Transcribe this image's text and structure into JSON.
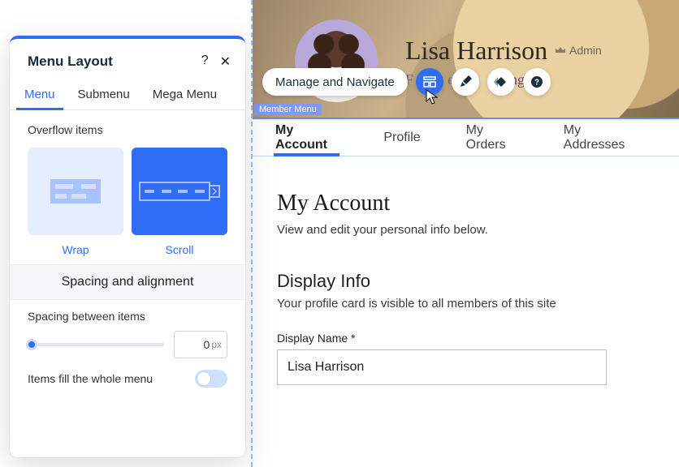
{
  "panel": {
    "title": "Menu Layout",
    "tabs": [
      "Menu",
      "Submenu",
      "Mega Menu"
    ],
    "activeTab": 0,
    "overflow_label": "Overflow items",
    "option_wrap": "Wrap",
    "option_scroll": "Scroll",
    "spacing_heading": "Spacing and alignment",
    "spacing_label": "Spacing between items",
    "spacing_value": "0",
    "spacing_unit": "px",
    "fill_label": "Items fill the whole menu"
  },
  "toolbar": {
    "label": "Manage and Navigate"
  },
  "profile": {
    "name": "Lisa Harrison",
    "role": "Admin",
    "subline_fragment": "owing",
    "badge": "Member Menu"
  },
  "tabs": {
    "items": [
      "My Account",
      "Profile",
      "My Orders",
      "My Addresses"
    ],
    "active": 0
  },
  "page": {
    "heading": "My Account",
    "sub": "View and edit your personal info below.",
    "section_heading": "Display Info",
    "section_sub": "Your profile card is visible to all members of this site",
    "field_label": "Display Name *",
    "field_value": "Lisa Harrison"
  }
}
